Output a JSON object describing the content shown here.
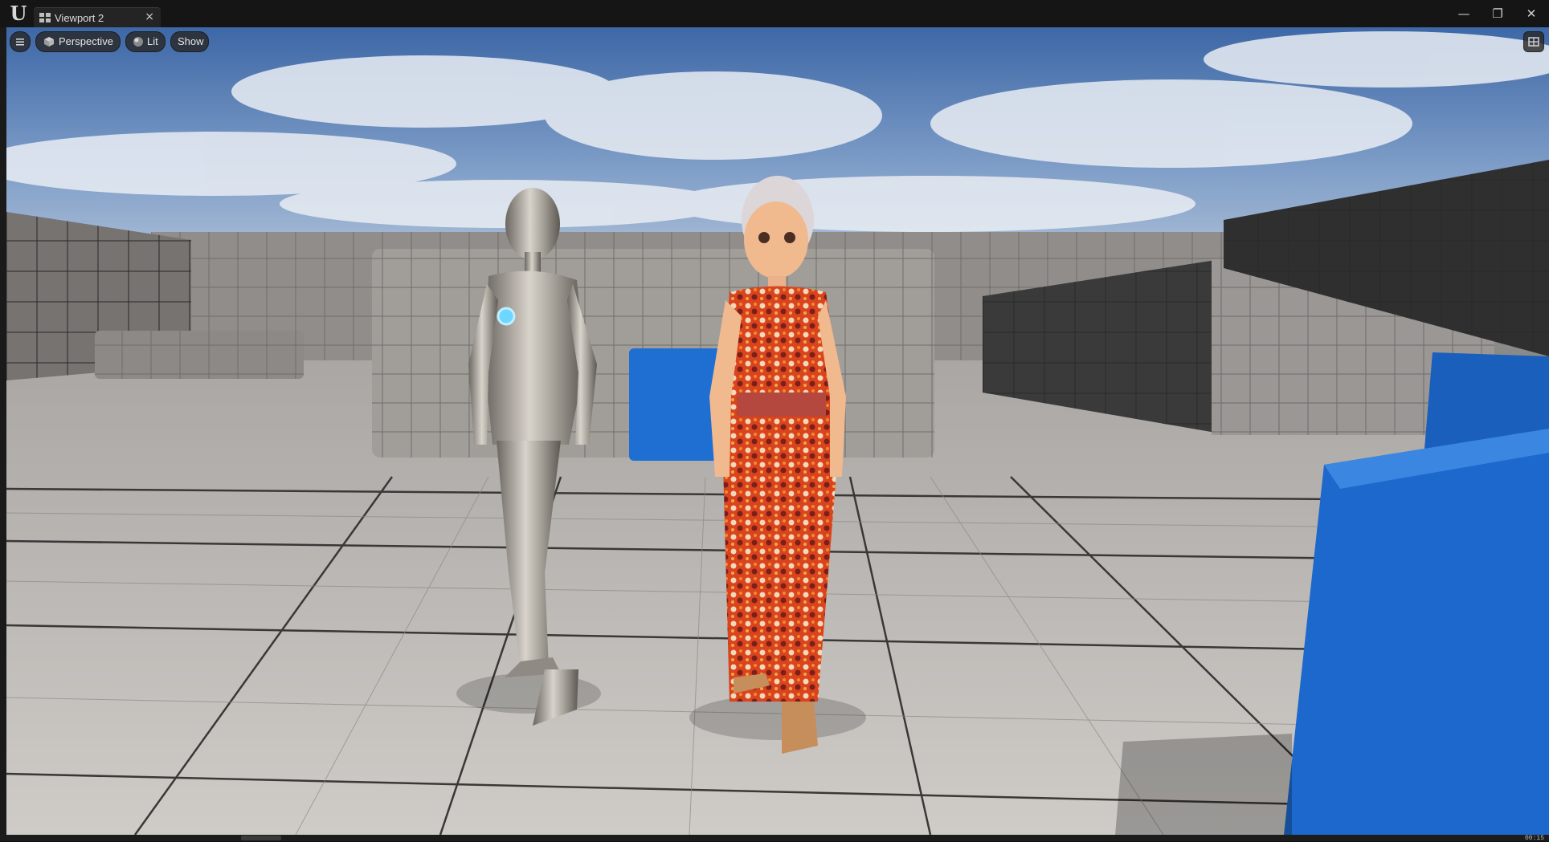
{
  "window": {
    "tab_title": "Viewport 2",
    "tab_close_glyph": "×",
    "minimize_glyph": "—",
    "restore_glyph": "❐",
    "close_glyph": "✕"
  },
  "viewport_toolbar": {
    "menu_icon": "hamburger-menu-icon",
    "view_mode_icon": "cube-icon",
    "view_mode_label": "Perspective",
    "lighting_icon": "sphere-icon",
    "lighting_label": "Lit",
    "show_label": "Show",
    "layout_icon": "viewport-layout-icon"
  },
  "colors": {
    "titlebar": "#151515",
    "tab": "#242424",
    "sky_top": "#3f6aa8",
    "floor": "#b9b6b2",
    "blue_cube": "#1e6fd0",
    "wall": "#8e8b88"
  },
  "status": {
    "bottom_readout": "00:15"
  }
}
